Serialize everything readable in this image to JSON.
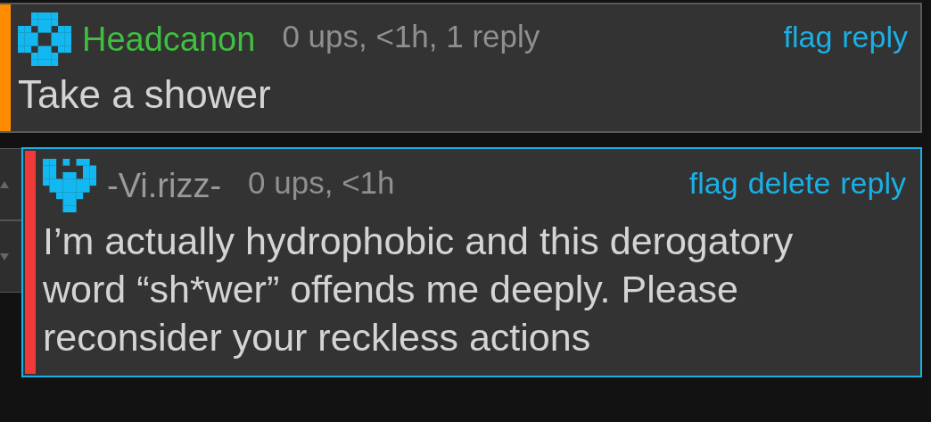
{
  "comments": [
    {
      "author": {
        "text": "Headcanon",
        "color": "#3fbf3f"
      },
      "color": "#ff8c00",
      "meta": "0 ups, <1h, 1 reply",
      "actions": [
        "flag",
        "reply"
      ],
      "highlighted": false,
      "vote_buttons": false,
      "text": "Take a shower"
    },
    {
      "author": {
        "text": "-Vi.rizz-",
        "color": "#9a9a9a"
      },
      "color": "#f03a3a",
      "meta": "0 ups, <1h",
      "actions": [
        "flag",
        "delete",
        "reply"
      ],
      "highlighted": true,
      "vote_buttons": true,
      "text": "I’m actually hydrophobic and this derogatory word “sh*wer” offends me deeply. Please reconsider your reckless actions"
    }
  ]
}
